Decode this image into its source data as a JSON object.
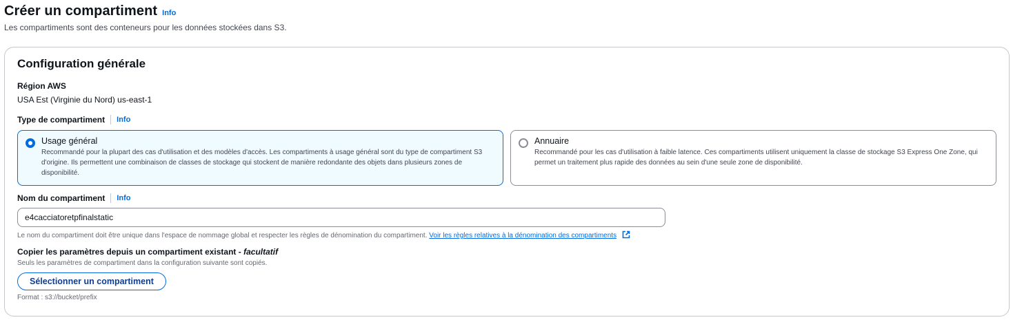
{
  "header": {
    "title": "Créer un compartiment",
    "info": "Info",
    "description": "Les compartiments sont des conteneurs pour les données stockées dans S3."
  },
  "general": {
    "title": "Configuration générale",
    "region_label": "Région AWS",
    "region_value": "USA Est (Virginie du Nord) us-east-1",
    "bucket_type_label": "Type de compartiment",
    "bucket_type_info": "Info",
    "options": [
      {
        "title": "Usage général",
        "description": "Recommandé pour la plupart des cas d'utilisation et des modèles d'accès. Les compartiments à usage général sont du type de compartiment S3 d'origine. Ils permettent une combinaison de classes de stockage qui stockent de manière redondante des objets dans plusieurs zones de disponibilité.",
        "selected": true
      },
      {
        "title": "Annuaire",
        "description": "Recommandé pour les cas d'utilisation à faible latence. Ces compartiments utilisent uniquement la classe de stockage S3 Express One Zone, qui permet un traitement plus rapide des données au sein d'une seule zone de disponibilité.",
        "selected": false
      }
    ],
    "bucket_name_label": "Nom du compartiment",
    "bucket_name_info": "Info",
    "bucket_name_value": "e4cacciatoretpfinalstatic",
    "bucket_name_hint": "Le nom du compartiment doit être unique dans l'espace de nommage global et respecter les règles de dénomination du compartiment.",
    "bucket_name_rules_link": "Voir les règles relatives à la dénomination des compartiments",
    "copy_label": "Copier les paramètres depuis un compartiment existant - ",
    "copy_optional": "facultatif",
    "copy_desc": "Seuls les paramètres de compartiment dans la configuration suivante sont copiés.",
    "copy_button": "Sélectionner un compartiment",
    "format_hint": "Format : s3://bucket/prefix"
  },
  "colors": {
    "accent": "#006ce0",
    "selected_bg": "#f0fbff",
    "border": "#8c8c94"
  }
}
